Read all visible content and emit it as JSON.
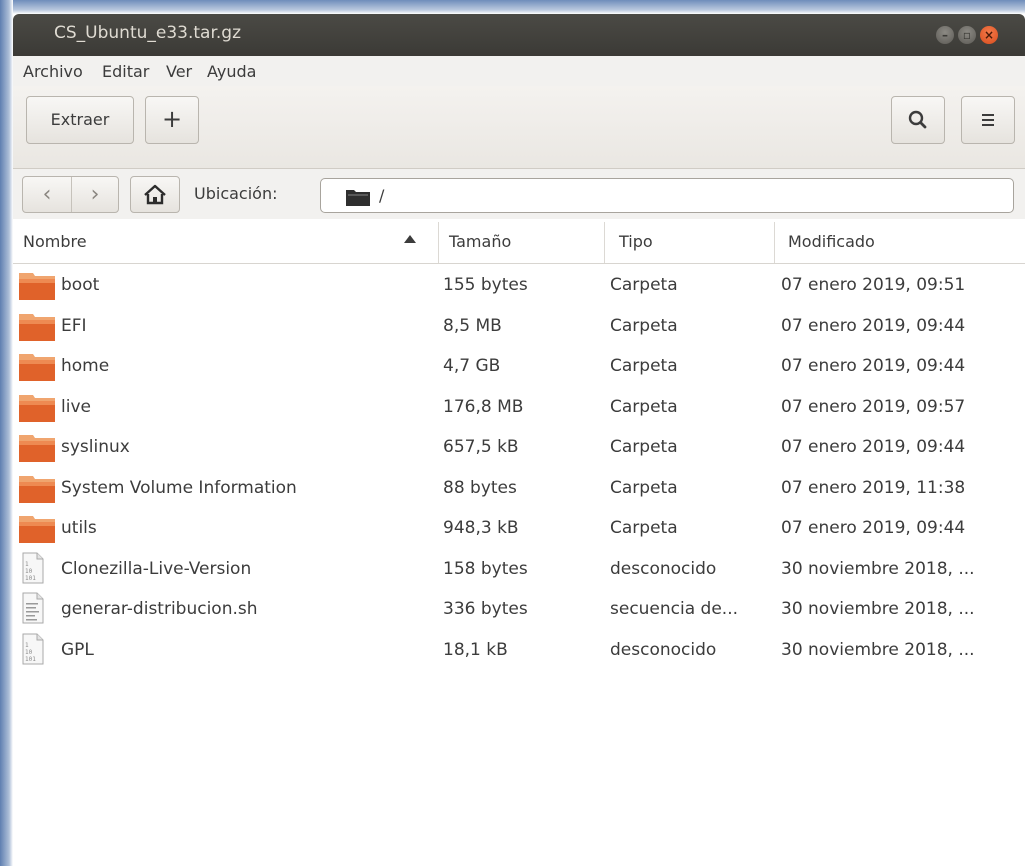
{
  "window": {
    "title": "CS_Ubuntu_e33.tar.gz",
    "controls": [
      "minimize-icon",
      "maximize-icon",
      "close-icon"
    ]
  },
  "menu": {
    "items": [
      "Archivo",
      "Editar",
      "Ver",
      "Ayuda"
    ]
  },
  "toolbar": {
    "extract_label": "Extraer",
    "add_label": "+",
    "search_icon": "search-icon",
    "menu_icon": "hamburger-menu-icon"
  },
  "location": {
    "label": "Ubicación:",
    "path": "/",
    "back_icon": "‹",
    "forward_icon": "›"
  },
  "columns": {
    "name": "Nombre",
    "size": "Tamaño",
    "type": "Tipo",
    "modified": "Modificado"
  },
  "files": [
    {
      "name": "boot",
      "size": "155 bytes",
      "type": "Carpeta",
      "modified": "07 enero 2019, 09:51",
      "icon": "folder"
    },
    {
      "name": "EFI",
      "size": "8,5 MB",
      "type": "Carpeta",
      "modified": "07 enero 2019, 09:44",
      "icon": "folder"
    },
    {
      "name": "home",
      "size": "4,7 GB",
      "type": "Carpeta",
      "modified": "07 enero 2019, 09:44",
      "icon": "folder"
    },
    {
      "name": "live",
      "size": "176,8 MB",
      "type": "Carpeta",
      "modified": "07 enero 2019, 09:57",
      "icon": "folder"
    },
    {
      "name": "syslinux",
      "size": "657,5 kB",
      "type": "Carpeta",
      "modified": "07 enero 2019, 09:44",
      "icon": "folder"
    },
    {
      "name": "System Volume Information",
      "size": "88 bytes",
      "type": "Carpeta",
      "modified": "07 enero 2019, 11:38",
      "icon": "folder"
    },
    {
      "name": "utils",
      "size": "948,3 kB",
      "type": "Carpeta",
      "modified": "07 enero 2019, 09:44",
      "icon": "folder"
    },
    {
      "name": "Clonezilla-Live-Version",
      "size": "158 bytes",
      "type": "desconocido",
      "modified": "30 noviembre 2018, ...",
      "icon": "binary-file"
    },
    {
      "name": "generar-distribucion.sh",
      "size": "336 bytes",
      "type": "secuencia de...",
      "modified": "30 noviembre 2018, ...",
      "icon": "script-file"
    },
    {
      "name": "GPL",
      "size": "18,1 kB",
      "type": "desconocido",
      "modified": "30 noviembre 2018, ...",
      "icon": "binary-file"
    }
  ],
  "colors": {
    "titlebar": "#3b3a36",
    "folder": "#e0622a",
    "close_button": "#e5562a",
    "text": "#3c3c3c"
  }
}
